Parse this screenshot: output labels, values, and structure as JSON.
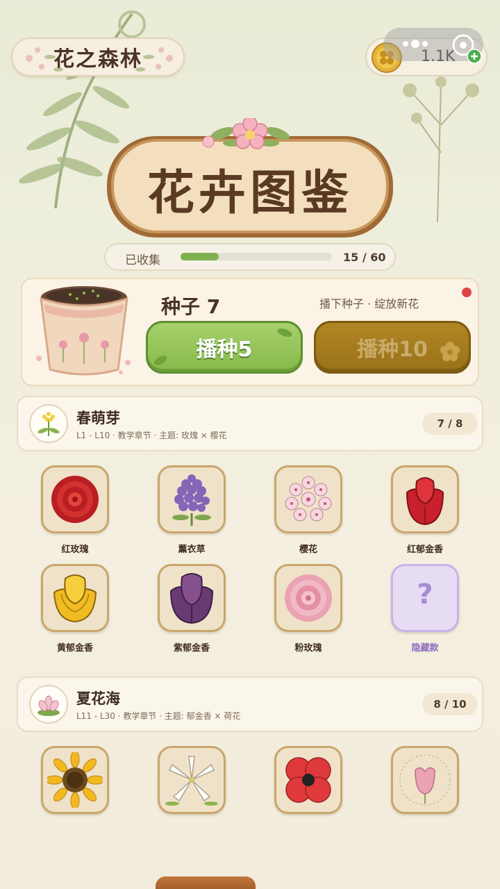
{
  "header": {
    "title": "花之森林",
    "coins": "1.1K"
  },
  "sign": {
    "text": "花卉图鉴"
  },
  "progress": {
    "label": "已收集",
    "count": "15 / 60",
    "fraction": 0.25
  },
  "seed": {
    "title": "种子 7",
    "subtitle": "播下种子 · 绽放新花",
    "sow5_label": "播种5",
    "sow10_label": "播种10"
  },
  "chapters": [
    {
      "name": "春萌芽",
      "meta": "L1 - L10 · 教学章节 · 主题: 玫瑰 × 樱花",
      "count": "7 / 8",
      "flowers": [
        "红玫瑰",
        "薰衣草",
        "樱花",
        "红郁金香",
        "黄郁金香",
        "紫郁金香",
        "粉玫瑰",
        "隐藏款"
      ]
    },
    {
      "name": "夏花海",
      "meta": "L11 - L30 · 教学章节 · 主题: 郁金香 × 荷花",
      "count": "8 / 10",
      "flowers": [
        "",
        "",
        "",
        ""
      ]
    }
  ],
  "colors": {
    "accent_green": "#86b94a",
    "accent_gold": "#9a711a",
    "progress_fill": "#7fb24f",
    "alert_red": "#e04545",
    "hidden_purple": "#a78cd0"
  },
  "icons": {
    "coin": "clover-coin-icon",
    "menu": "more-dots-icon",
    "target": "target-icon",
    "plus": "plus-icon"
  }
}
